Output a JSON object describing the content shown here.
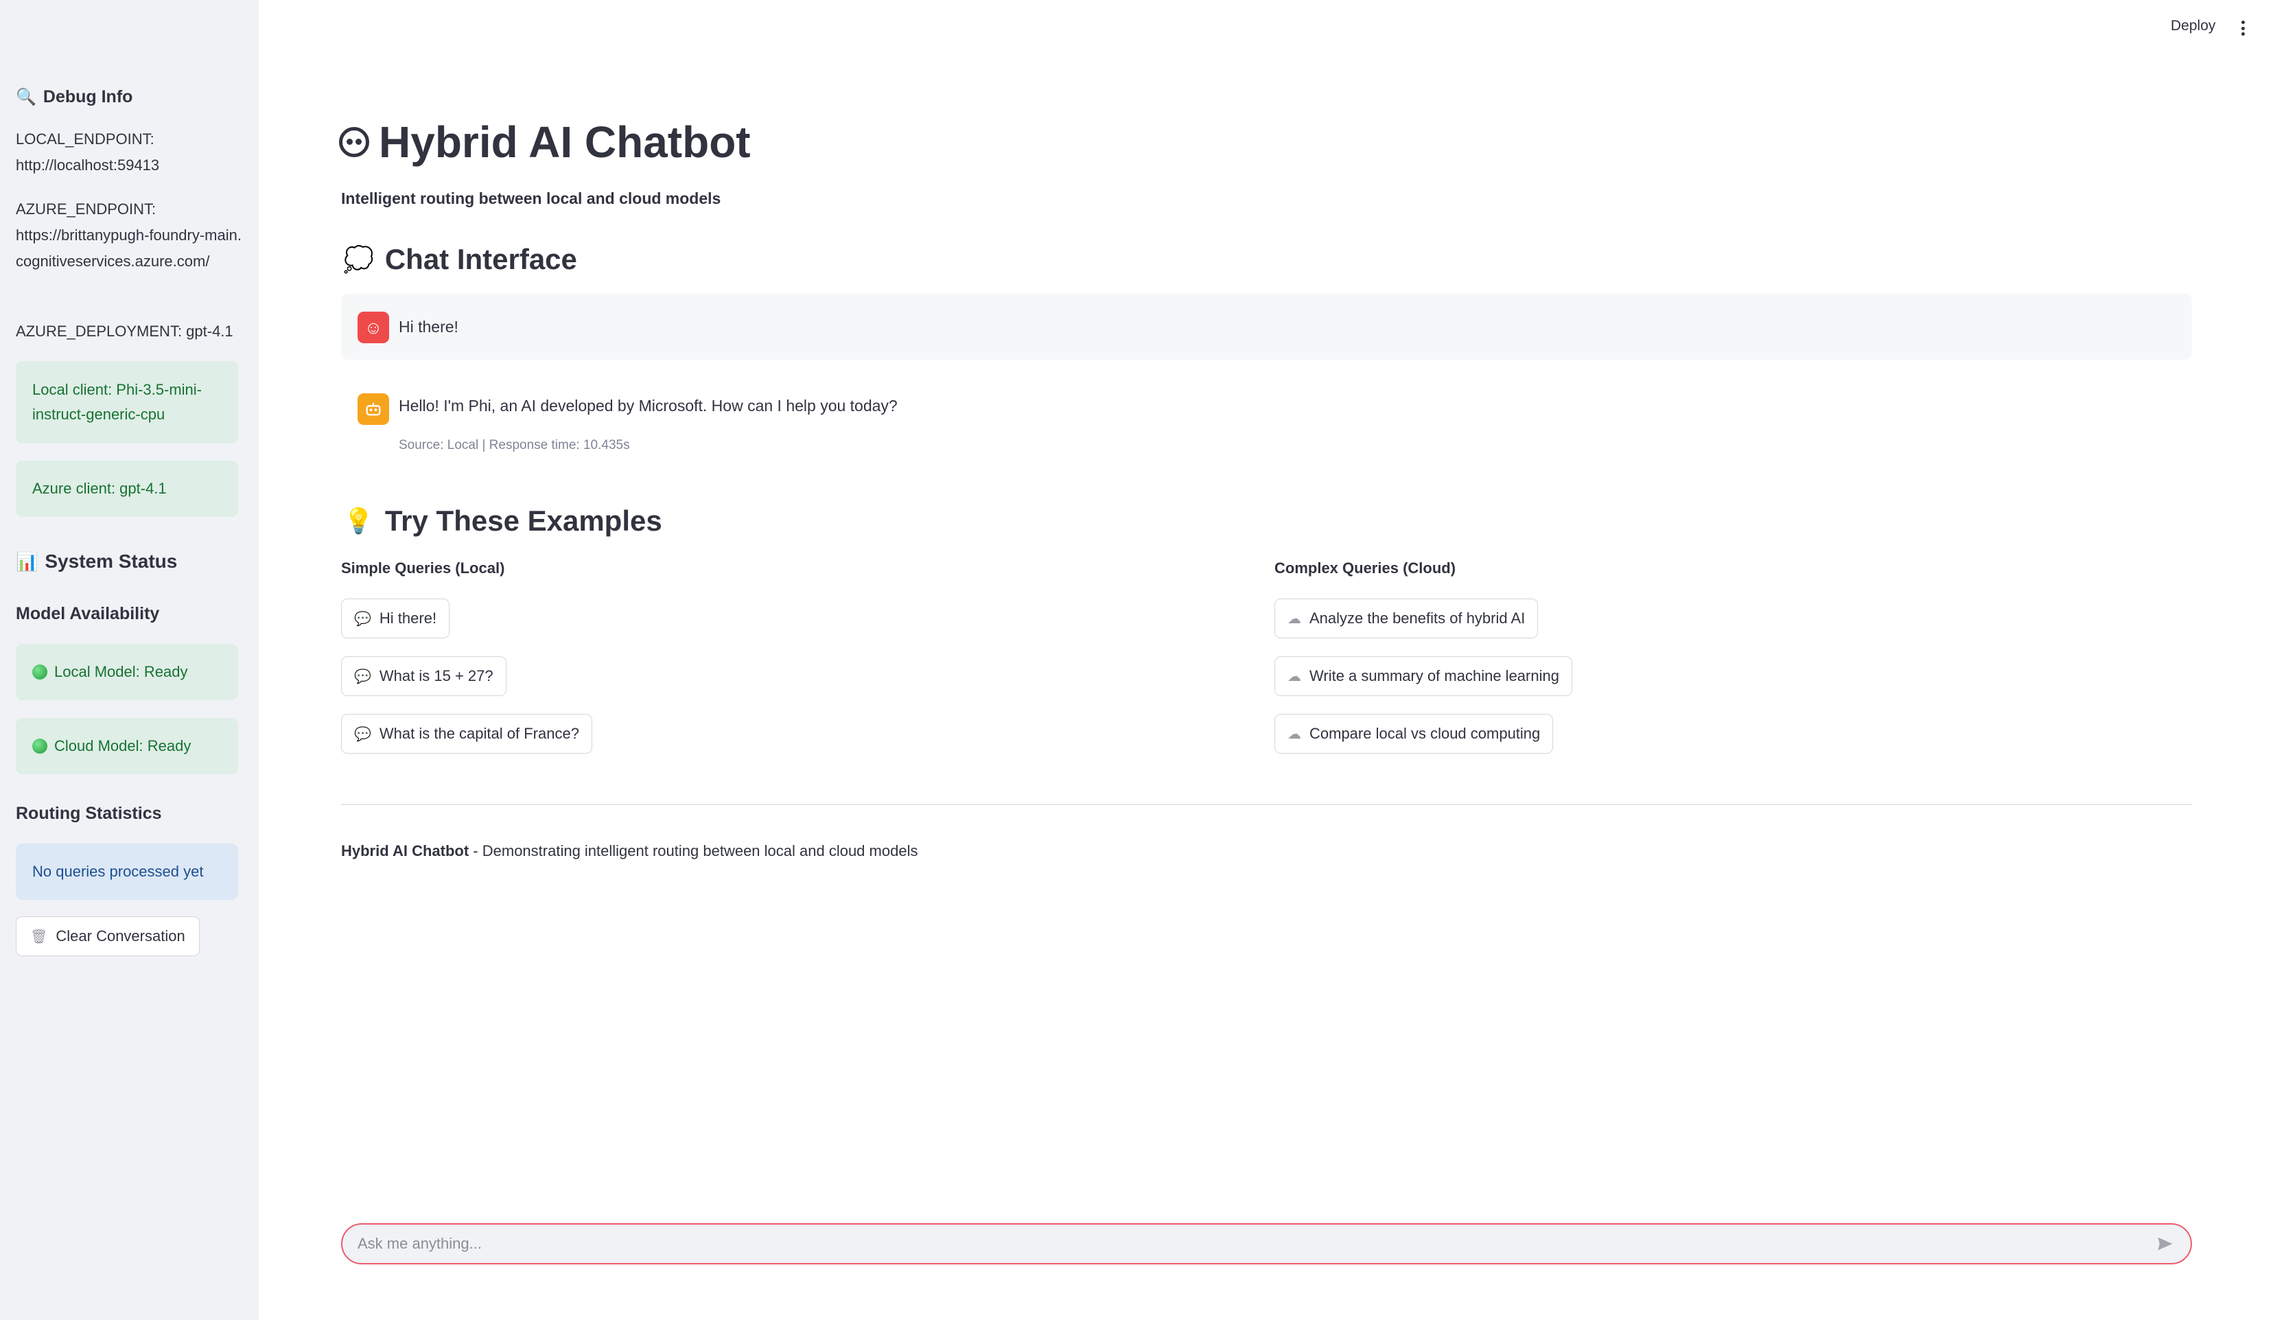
{
  "sidebar": {
    "debug_heading": "Debug Info",
    "local_endpoint_label": "LOCAL_ENDPOINT:",
    "local_endpoint_value": "http://localhost:59413",
    "azure_endpoint_label": "AZURE_ENDPOINT:",
    "azure_endpoint_value": "https://brittanypugh-foundry-main.cognitiveservices.azure.com/",
    "azure_deployment": "AZURE_DEPLOYMENT: gpt-4.1",
    "local_client": "Local client: Phi-3.5-mini-instruct-generic-cpu",
    "azure_client": "Azure client: gpt-4.1",
    "system_status_heading": "System Status",
    "model_availability_heading": "Model Availability",
    "local_model_status": "Local Model: Ready",
    "cloud_model_status": "Cloud Model: Ready",
    "routing_heading": "Routing Statistics",
    "routing_info": "No queries processed yet",
    "clear_button": "Clear Conversation"
  },
  "header": {
    "deploy_label": "Deploy"
  },
  "main": {
    "title": "Hybrid AI Chatbot",
    "subtitle": "Intelligent routing between local and cloud models",
    "chat_heading": "Chat Interface",
    "messages": [
      {
        "role": "user",
        "text": "Hi there!"
      },
      {
        "role": "assistant",
        "text": "Hello! I'm Phi, an AI developed by Microsoft. How can I help you today?",
        "meta": "Source: Local | Response time: 10.435s"
      }
    ],
    "examples_heading": "Try These Examples",
    "simple_heading": "Simple Queries (Local)",
    "complex_heading": "Complex Queries (Cloud)",
    "simple_queries": [
      "Hi there!",
      "What is 15 + 27?",
      "What is the capital of France?"
    ],
    "complex_queries": [
      "Analyze the benefits of hybrid AI",
      "Write a summary of machine learning",
      "Compare local vs cloud computing"
    ],
    "footer_bold": "Hybrid AI Chatbot",
    "footer_rest": " - Demonstrating intelligent routing between local and cloud models"
  },
  "input": {
    "placeholder": "Ask me anything..."
  },
  "colors": {
    "sidebar_bg": "#f0f2f6",
    "success_bg": "#dfeee6",
    "success_text": "#177233",
    "info_bg": "#dce8f6",
    "user_avatar": "#ef4a4a",
    "bot_avatar": "#f7a41d",
    "input_border": "#ef5b6b"
  }
}
